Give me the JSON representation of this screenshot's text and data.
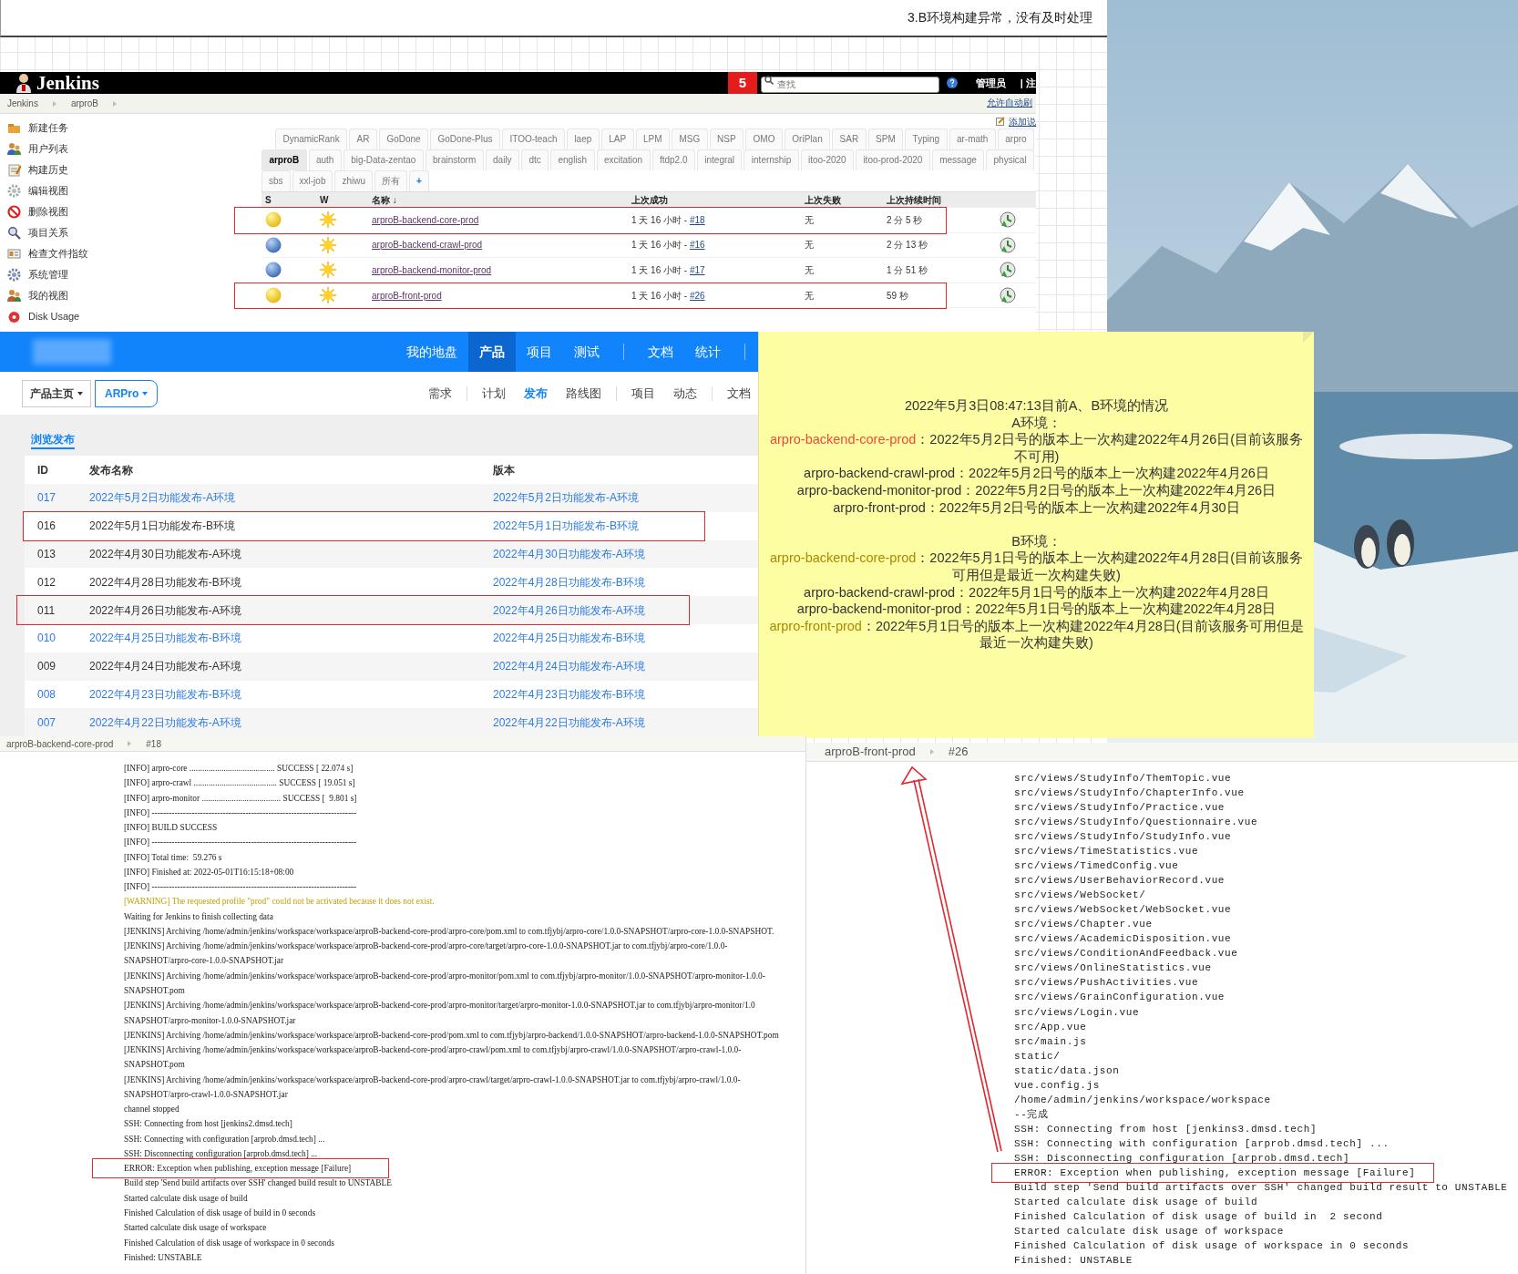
{
  "caption": {
    "text": "3.B环境构建异常，没有及时处理"
  },
  "jenkins": {
    "logo": "Jenkins",
    "alert_count": "5",
    "search": {
      "placeholder": "查找"
    },
    "user": "管理员",
    "logout": "| 注",
    "breadcrumbs": [
      "Jenkins",
      "arproB"
    ],
    "auto_refresh": "允许自动刷",
    "sidebar": [
      "新建任务",
      "用户列表",
      "构建历史",
      "编辑视图",
      "删除视图",
      "项目关系",
      "检查文件指纹",
      "系统管理",
      "我的视图",
      "Disk Usage"
    ],
    "add_description": "添加说",
    "view_tab_rows": [
      [
        {
          "label": "DynamicRank",
          "kind": "view",
          "selected": false
        },
        {
          "label": "AR",
          "kind": "view",
          "selected": false
        },
        {
          "label": "GoDone",
          "kind": "view",
          "selected": false
        },
        {
          "label": "GoDone-Plus",
          "kind": "view",
          "selected": false
        },
        {
          "label": "ITOO-teach",
          "kind": "view",
          "selected": false
        },
        {
          "label": "laep",
          "kind": "view",
          "selected": false
        },
        {
          "label": "LAP",
          "kind": "view",
          "selected": false
        },
        {
          "label": "LPM",
          "kind": "view",
          "selected": false
        },
        {
          "label": "MSG",
          "kind": "view",
          "selected": false
        },
        {
          "label": "NSP",
          "kind": "view",
          "selected": false
        },
        {
          "label": "OMO",
          "kind": "view",
          "selected": false
        },
        {
          "label": "OriPlan",
          "kind": "view",
          "selected": false
        },
        {
          "label": "SAR",
          "kind": "view",
          "selected": false
        },
        {
          "label": "SPM",
          "kind": "view",
          "selected": false
        },
        {
          "label": "Typing",
          "kind": "view",
          "selected": false
        },
        {
          "label": "ar-math",
          "kind": "view",
          "selected": false
        },
        {
          "label": "arpro",
          "kind": "view",
          "selected": false
        }
      ],
      [
        {
          "label": "arproB",
          "kind": "view",
          "selected": true
        },
        {
          "label": "auth",
          "kind": "view",
          "selected": false
        },
        {
          "label": "big-Data-zentao",
          "kind": "view",
          "selected": false
        },
        {
          "label": "brainstorm",
          "kind": "view",
          "selected": false
        },
        {
          "label": "daily",
          "kind": "view",
          "selected": false
        },
        {
          "label": "dtc",
          "kind": "view",
          "selected": false
        },
        {
          "label": "english",
          "kind": "view",
          "selected": false
        },
        {
          "label": "excitation",
          "kind": "view",
          "selected": false
        },
        {
          "label": "ftdp2.0",
          "kind": "view",
          "selected": false
        },
        {
          "label": "integral",
          "kind": "view",
          "selected": false
        },
        {
          "label": "internship",
          "kind": "view",
          "selected": false
        },
        {
          "label": "itoo-2020",
          "kind": "view",
          "selected": false
        },
        {
          "label": "itoo-prod-2020",
          "kind": "view",
          "selected": false
        },
        {
          "label": "message",
          "kind": "view",
          "selected": false
        },
        {
          "label": "physical",
          "kind": "view",
          "selected": false
        }
      ],
      [
        {
          "label": "sbs",
          "kind": "view",
          "selected": false
        },
        {
          "label": "xxl-job",
          "kind": "view",
          "selected": false
        },
        {
          "label": "zhiwu",
          "kind": "view",
          "selected": false
        },
        {
          "label": "所有",
          "kind": "view",
          "selected": false
        },
        {
          "label": "+",
          "kind": "add",
          "selected": false
        }
      ]
    ],
    "columns": [
      "S",
      "W",
      "名称 ↓",
      "上次成功",
      "上次失败",
      "上次持续时间"
    ],
    "jobs": [
      {
        "unstable": true,
        "name": "arproB-backend-core-prod",
        "last_success": "1 天 16 小时 - ",
        "build": "#18",
        "last_failure": "无",
        "duration": "2 分 5 秒",
        "highlighted": true
      },
      {
        "unstable": false,
        "name": "arproB-backend-crawl-prod",
        "last_success": "1 天 16 小时 - ",
        "build": "#16",
        "last_failure": "无",
        "duration": "2 分 13 秒",
        "highlighted": false
      },
      {
        "unstable": false,
        "name": "arproB-backend-monitor-prod",
        "last_success": "1 天 16 小时 - ",
        "build": "#17",
        "last_failure": "无",
        "duration": "1 分 51 秒",
        "highlighted": false
      },
      {
        "unstable": true,
        "name": "arproB-front-prod",
        "last_success": "1 天 16 小时 - ",
        "build": "#26",
        "last_failure": "无",
        "duration": "59 秒",
        "highlighted": true
      }
    ]
  },
  "zentao": {
    "nav": [
      [
        {
          "label": "我的地盘",
          "selected": false
        },
        {
          "label": "产品",
          "selected": true
        },
        {
          "label": "项目",
          "selected": false
        },
        {
          "label": "测试",
          "selected": false
        }
      ],
      [
        {
          "label": "文档",
          "selected": false
        },
        {
          "label": "统计",
          "selected": false
        }
      ]
    ],
    "product_menu": "产品主页",
    "product": "ARPro",
    "menu": [
      [
        {
          "label": "需求",
          "selected": false
        }
      ],
      [
        {
          "label": "计划",
          "selected": false
        },
        {
          "label": "发布",
          "selected": true
        },
        {
          "label": "路线图",
          "selected": false
        }
      ],
      [
        {
          "label": "项目",
          "selected": false
        },
        {
          "label": "动态",
          "selected": false
        }
      ],
      [
        {
          "label": "文档",
          "selected": false
        }
      ]
    ],
    "subtab": "浏览发布",
    "columns": [
      "ID",
      "发布名称",
      "版本"
    ],
    "rows": [
      {
        "id": "017",
        "name": "2022年5月2日功能发布-A环境",
        "version": "2022年5月2日功能发布-A环境",
        "visited": false,
        "highlighted": false
      },
      {
        "id": "016",
        "name": "2022年5月1日功能发布-B环境",
        "version": "2022年5月1日功能发布-B环境",
        "visited": true,
        "highlighted": true
      },
      {
        "id": "013",
        "name": "2022年4月30日功能发布-A环境",
        "version": "2022年4月30日功能发布-A环境",
        "visited": true,
        "highlighted": false
      },
      {
        "id": "012",
        "name": "2022年4月28日功能发布-B环境",
        "version": "2022年4月28日功能发布-B环境",
        "visited": true,
        "highlighted": false
      },
      {
        "id": "011",
        "name": "2022年4月26日功能发布-A环境",
        "version": "2022年4月26日功能发布-A环境",
        "visited": true,
        "highlighted": true
      },
      {
        "id": "010",
        "name": "2022年4月25日功能发布-B环境",
        "version": "2022年4月25日功能发布-B环境",
        "visited": false,
        "highlighted": false
      },
      {
        "id": "009",
        "name": "2022年4月24日功能发布-A环境",
        "version": "2022年4月24日功能发布-A环境",
        "visited": true,
        "highlighted": false
      },
      {
        "id": "008",
        "name": "2022年4月23日功能发布-B环境",
        "version": "2022年4月23日功能发布-B环境",
        "visited": false,
        "highlighted": false
      },
      {
        "id": "007",
        "name": "2022年4月22日功能发布-A环境",
        "version": "2022年4月22日功能发布-A环境",
        "visited": false,
        "highlighted": false
      }
    ]
  },
  "note": {
    "title": "2022年5月3日08:47:13目前A、B环境的情况",
    "sections": [
      {
        "heading": "A环境：",
        "entries": [
          {
            "job": "arpro-backend-core-prod",
            "color": "#f2483a",
            "text": "：2022年5月2日号的版本上一次构建2022年4月26日(目前该服务不可用)"
          },
          {
            "job": "arpro-backend-crawl-prod",
            "text": "：2022年5月2日号的版本上一次构建2022年4月26日"
          },
          {
            "job": "arpro-backend-monitor-prod",
            "text": "：2022年5月2日号的版本上一次构建2022年4月26日"
          },
          {
            "job": "arpro-front-prod",
            "text": "：2022年5月2日号的版本上一次构建2022年4月30日"
          }
        ]
      },
      {
        "heading": "B环境：",
        "entries": [
          {
            "job": "arpro-backend-core-prod",
            "color": "#a88a00",
            "text": "：2022年5月1日号的版本上一次构建2022年4月28日(目前该服务可用但是最近一次构建失败)"
          },
          {
            "job": "arpro-backend-crawl-prod",
            "text": "：2022年5月1日号的版本上一次构建2022年4月28日"
          },
          {
            "job": "arpro-backend-monitor-prod",
            "text": "：2022年5月1日号的版本上一次构建2022年4月28日"
          },
          {
            "job": "arpro-front-prod",
            "color": "#a88a00",
            "text": "：2022年5月1日号的版本上一次构建2022年4月28日(目前该服务可用但是最近一次构建失败)"
          }
        ]
      }
    ]
  },
  "left_log": {
    "breadcrumbs": [
      "arproB-backend-core-prod",
      "#18"
    ],
    "lines": [
      {
        "kind": "plain",
        "text": "[INFO] arpro-core ........................................ SUCCESS [ 22.074 s]"
      },
      {
        "kind": "plain",
        "text": "[INFO] arpro-crawl ....................................... SUCCESS [ 19.051 s]"
      },
      {
        "kind": "plain",
        "text": "[INFO] arpro-monitor ..................................... SUCCESS [  9.801 s]"
      },
      {
        "kind": "plain",
        "text": "[INFO] ------------------------------------------------------------------------"
      },
      {
        "kind": "plain",
        "text": "[INFO] BUILD SUCCESS"
      },
      {
        "kind": "plain",
        "text": "[INFO] ------------------------------------------------------------------------"
      },
      {
        "kind": "plain",
        "text": "[INFO] Total time:  59.276 s"
      },
      {
        "kind": "plain",
        "text": "[INFO] Finished at: 2022-05-01T16:15:18+08:00"
      },
      {
        "kind": "plain",
        "text": "[INFO] ------------------------------------------------------------------------"
      },
      {
        "kind": "warning",
        "text": "[WARNING] The requested profile \"prod\" could not be activated because it does not exist."
      },
      {
        "kind": "plain",
        "text": "Waiting for Jenkins to finish collecting data"
      },
      {
        "kind": "plain",
        "text": "[JENKINS] Archiving /home/admin/jenkins/workspace/workspace/arproB-backend-core-prod/arpro-core/pom.xml to com.tfjybj/arpro-core/1.0.0-SNAPSHOT/arpro-core-1.0.0-SNAPSHOT."
      },
      {
        "kind": "plain",
        "text": "[JENKINS] Archiving /home/admin/jenkins/workspace/workspace/arproB-backend-core-prod/arpro-core/target/arpro-core-1.0.0-SNAPSHOT.jar to com.tfjybj/arpro-core/1.0.0-"
      },
      {
        "kind": "plain",
        "text": "SNAPSHOT/arpro-core-1.0.0-SNAPSHOT.jar"
      },
      {
        "kind": "plain",
        "text": "[JENKINS] Archiving /home/admin/jenkins/workspace/workspace/arproB-backend-core-prod/arpro-monitor/pom.xml to com.tfjybj/arpro-monitor/1.0.0-SNAPSHOT/arpro-monitor-1.0.0-"
      },
      {
        "kind": "plain",
        "text": "SNAPSHOT.pom"
      },
      {
        "kind": "plain",
        "text": "[JENKINS] Archiving /home/admin/jenkins/workspace/workspace/arproB-backend-core-prod/arpro-monitor/target/arpro-monitor-1.0.0-SNAPSHOT.jar to com.tfjybj/arpro-monitor/1.0"
      },
      {
        "kind": "plain",
        "text": "SNAPSHOT/arpro-monitor-1.0.0-SNAPSHOT.jar"
      },
      {
        "kind": "plain",
        "text": "[JENKINS] Archiving /home/admin/jenkins/workspace/workspace/arproB-backend-core-prod/pom.xml to com.tfjybj/arpro-backend/1.0.0-SNAPSHOT/arpro-backend-1.0.0-SNAPSHOT.pom"
      },
      {
        "kind": "plain",
        "text": "[JENKINS] Archiving /home/admin/jenkins/workspace/workspace/arproB-backend-core-prod/arpro-crawl/pom.xml to com.tfjybj/arpro-crawl/1.0.0-SNAPSHOT/arpro-crawl-1.0.0-"
      },
      {
        "kind": "plain",
        "text": "SNAPSHOT.pom"
      },
      {
        "kind": "plain",
        "text": "[JENKINS] Archiving /home/admin/jenkins/workspace/workspace/arproB-backend-core-prod/arpro-crawl/target/arpro-crawl-1.0.0-SNAPSHOT.jar to com.tfjybj/arpro-crawl/1.0.0-"
      },
      {
        "kind": "plain",
        "text": "SNAPSHOT/arpro-crawl-1.0.0-SNAPSHOT.jar"
      },
      {
        "kind": "plain",
        "text": "channel stopped"
      },
      {
        "kind": "plain",
        "text": "SSH: Connecting from host [jenkins2.dmsd.tech]"
      },
      {
        "kind": "plain",
        "text": "SSH: Connecting with configuration [arprob.dmsd.tech] ..."
      },
      {
        "kind": "plain",
        "text": "SSH: Disconnecting configuration [arprob.dmsd.tech] ..."
      },
      {
        "kind": "error",
        "text": "ERROR: Exception when publishing, exception message [Failure]"
      },
      {
        "kind": "plain",
        "text": "Build step 'Send build artifacts over SSH' changed build result to UNSTABLE"
      },
      {
        "kind": "plain",
        "text": "Started calculate disk usage of build"
      },
      {
        "kind": "plain",
        "text": "Finished Calculation of disk usage of build in 0 seconds"
      },
      {
        "kind": "plain",
        "text": "Started calculate disk usage of workspace"
      },
      {
        "kind": "plain",
        "text": "Finished Calculation of disk usage of workspace in 0 seconds"
      },
      {
        "kind": "plain",
        "text": "Finished: UNSTABLE"
      }
    ]
  },
  "right_log": {
    "breadcrumbs": [
      "arproB-front-prod",
      "#26"
    ],
    "lines": [
      {
        "kind": "plain",
        "text": "src/views/StudyInfo/ThemTopic.vue"
      },
      {
        "kind": "plain",
        "text": "src/views/StudyInfo/ChapterInfo.vue"
      },
      {
        "kind": "plain",
        "text": "src/views/StudyInfo/Practice.vue"
      },
      {
        "kind": "plain",
        "text": "src/views/StudyInfo/Questionnaire.vue"
      },
      {
        "kind": "plain",
        "text": "src/views/StudyInfo/StudyInfo.vue"
      },
      {
        "kind": "plain",
        "text": "src/views/TimeStatistics.vue"
      },
      {
        "kind": "plain",
        "text": "src/views/TimedConfig.vue"
      },
      {
        "kind": "plain",
        "text": "src/views/UserBehaviorRecord.vue"
      },
      {
        "kind": "plain",
        "text": "src/views/WebSocket/"
      },
      {
        "kind": "plain",
        "text": "src/views/WebSocket/WebSocket.vue"
      },
      {
        "kind": "plain",
        "text": "src/views/Chapter.vue"
      },
      {
        "kind": "plain",
        "text": "src/views/AcademicDisposition.vue"
      },
      {
        "kind": "plain",
        "text": "src/views/ConditionAndFeedback.vue"
      },
      {
        "kind": "plain",
        "text": "src/views/OnlineStatistics.vue"
      },
      {
        "kind": "plain",
        "text": "src/views/PushActivities.vue"
      },
      {
        "kind": "plain",
        "text": "src/views/GrainConfiguration.vue"
      },
      {
        "kind": "plain",
        "text": "src/views/Login.vue"
      },
      {
        "kind": "plain",
        "text": "src/App.vue"
      },
      {
        "kind": "plain",
        "text": "src/main.js"
      },
      {
        "kind": "plain",
        "text": "static/"
      },
      {
        "kind": "plain",
        "text": "static/data.json"
      },
      {
        "kind": "plain",
        "text": "vue.config.js"
      },
      {
        "kind": "plain",
        "text": "/home/admin/jenkins/workspace/workspace"
      },
      {
        "kind": "plain",
        "text": "--完成"
      },
      {
        "kind": "plain",
        "text": "SSH: Connecting from host [jenkins3.dmsd.tech]"
      },
      {
        "kind": "plain",
        "text": "SSH: Connecting with configuration [arprob.dmsd.tech] ..."
      },
      {
        "kind": "plain",
        "text": "SSH: Disconnecting configuration [arprob.dmsd.tech]"
      },
      {
        "kind": "error",
        "text": "ERROR: Exception when publishing, exception message [Failure]"
      },
      {
        "kind": "plain",
        "text": "Build step 'Send build artifacts over SSH' changed build result to UNSTABLE"
      },
      {
        "kind": "plain",
        "text": "Started calculate disk usage of build"
      },
      {
        "kind": "plain",
        "text": "Finished Calculation of disk usage of build in  2 second"
      },
      {
        "kind": "plain",
        "text": "Started calculate disk usage of workspace"
      },
      {
        "kind": "plain",
        "text": "Finished Calculation of disk usage of workspace in 0 seconds"
      },
      {
        "kind": "plain",
        "text": "Finished: UNSTABLE"
      }
    ]
  }
}
